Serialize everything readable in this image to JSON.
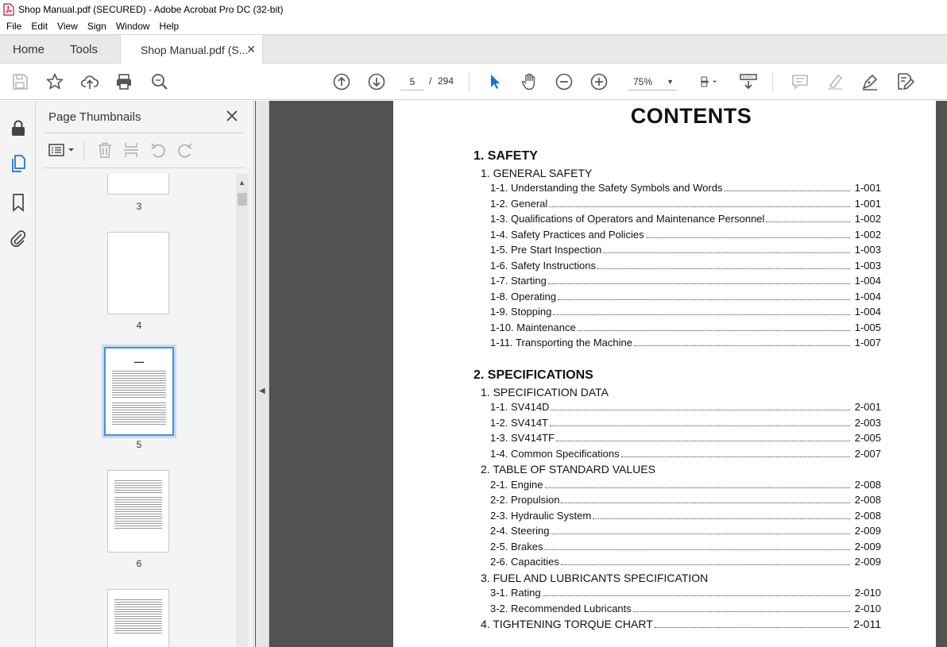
{
  "window": {
    "title": "Shop Manual.pdf (SECURED) - Adobe Acrobat Pro DC (32-bit)"
  },
  "menu": [
    "File",
    "Edit",
    "View",
    "Sign",
    "Window",
    "Help"
  ],
  "tabs": {
    "home": "Home",
    "tools": "Tools",
    "document": "Shop Manual.pdf (S..."
  },
  "toolbar": {
    "current_page": "5",
    "page_separator": "/",
    "total_pages": "294",
    "zoom": "75%"
  },
  "panel": {
    "title": "Page Thumbnails",
    "thumbnails": [
      {
        "label": "3"
      },
      {
        "label": "4"
      },
      {
        "label": "5",
        "selected": true
      },
      {
        "label": "6"
      }
    ]
  },
  "document": {
    "title": "CONTENTS",
    "sections": [
      {
        "heading": "1. SAFETY",
        "groups": [
          {
            "title": "1. GENERAL SAFETY",
            "entries": [
              {
                "text": "1-1. Understanding the Safety Symbols and Words",
                "page": "1-001"
              },
              {
                "text": "1-2. General",
                "page": "1-001"
              },
              {
                "text": "1-3. Qualifications of Operators and Maintenance Personnel",
                "page": "1-002"
              },
              {
                "text": "1-4. Safety Practices and Policies",
                "page": "1-002"
              },
              {
                "text": "1-5. Pre Start Inspection",
                "page": "1-003"
              },
              {
                "text": "1-6. Safety Instructions",
                "page": "1-003"
              },
              {
                "text": "1-7. Starting",
                "page": "1-004"
              },
              {
                "text": "1-8. Operating",
                "page": "1-004"
              },
              {
                "text": "1-9. Stopping",
                "page": "1-004"
              },
              {
                "text": "1-10. Maintenance",
                "page": "1-005"
              },
              {
                "text": "1-11. Transporting the Machine",
                "page": "1-007"
              }
            ]
          }
        ]
      },
      {
        "heading": "2. SPECIFICATIONS",
        "groups": [
          {
            "title": "1. SPECIFICATION DATA",
            "entries": [
              {
                "text": "1-1. SV414D",
                "page": "2-001"
              },
              {
                "text": "1-2. SV414T",
                "page": "2-003"
              },
              {
                "text": "1-3. SV414TF",
                "page": "2-005"
              },
              {
                "text": "1-4. Common Specifications",
                "page": "2-007"
              }
            ]
          },
          {
            "title": "2. TABLE OF STANDARD VALUES",
            "entries": [
              {
                "text": "2-1. Engine",
                "page": "2-008"
              },
              {
                "text": "2-2. Propulsion",
                "page": "2-008"
              },
              {
                "text": "2-3. Hydraulic System",
                "page": "2-008"
              },
              {
                "text": "2-4. Steering",
                "page": "2-009"
              },
              {
                "text": "2-5. Brakes",
                "page": "2-009"
              },
              {
                "text": "2-6. Capacities",
                "page": "2-009"
              }
            ]
          },
          {
            "title": "3. FUEL AND LUBRICANTS SPECIFICATION",
            "entries": [
              {
                "text": "3-1. Rating",
                "page": "2-010"
              },
              {
                "text": "3-2. Recommended Lubricants",
                "page": "2-010"
              }
            ]
          }
        ],
        "trailing_entry": {
          "text": "4. TIGHTENING TORQUE CHART",
          "page": "2-011"
        }
      }
    ]
  }
}
